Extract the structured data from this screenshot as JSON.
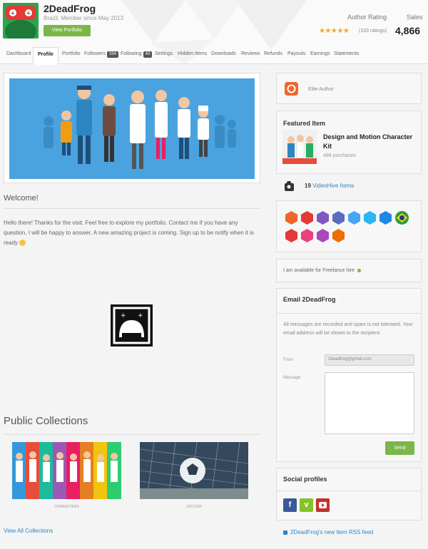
{
  "profile": {
    "username": "2DeadFrog",
    "subtitle": "Brazil, Member since May 2013",
    "view_portfolio_label": "View Portfolio",
    "rating_label": "Author Rating",
    "stars": "★★★★★",
    "ratings_count": "(103 ratings)",
    "sales_label": "Sales",
    "sales_value": "4,866"
  },
  "tabs": {
    "dashboard": "Dashboard",
    "profile": "Profile",
    "portfolio": "Portfolio",
    "followers": "Followers",
    "followers_count": "334",
    "following": "Following",
    "following_count": "43",
    "settings": "Settings",
    "hidden_items": "Hidden Items",
    "downloads": "Downloads",
    "reviews": "Reviews",
    "refunds": "Refunds",
    "payouts": "Payouts",
    "earnings": "Earnings",
    "statements": "Statements"
  },
  "main": {
    "welcome_title": "Welcome!",
    "welcome_text": "Hello there! Thanks for the visit. Feel free to explore my portfolio. Contact me if you have any question, I will be happy to answer. A new amazing project is coming. Sign up to be notify when it is ready",
    "public_collections_title": "Public Collections",
    "collections": [
      {
        "label": "Characters"
      },
      {
        "label": "Soccer"
      }
    ],
    "view_all_label": "View All Collections"
  },
  "sidebar": {
    "elite_label": "Elite Author",
    "featured_title": "Featured Item",
    "featured_name": "Design and Motion Character Kit",
    "featured_purchases": "488 purchases",
    "videohive_count": "19",
    "videohive_link": "VideoHive Items",
    "freelance_text": "I am available for Freelance hire",
    "email_title": "Email 2DeadFrog",
    "email_note": "All messages are recorded and spam is not tolerated. Your email address will be shown to the recipient.",
    "from_label": "From",
    "from_value": "2deadfrog@gmail.com",
    "message_label": "Message",
    "send_label": "Send",
    "social_title": "Social profiles",
    "rss_text": "2DeadFrog's new item RSS feed"
  },
  "colors": {
    "accent_green": "#7ab648",
    "link_blue": "#2b86c5",
    "banner_blue": "#4aa3df",
    "elite_orange": "#f06529"
  },
  "icons": {
    "social": [
      "facebook-icon",
      "vimeo-icon",
      "youtube-icon"
    ]
  }
}
